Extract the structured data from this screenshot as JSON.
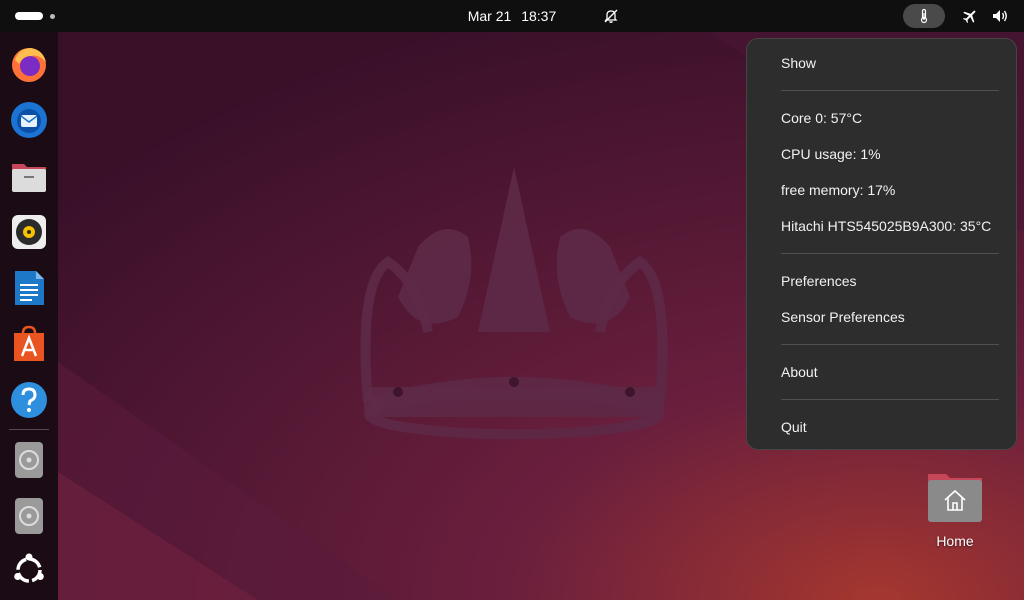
{
  "topbar": {
    "date": "Mar 21",
    "time": "18:37",
    "icons": [
      "bell-off-icon",
      "thermometer-icon",
      "airplane-mode-icon",
      "volume-icon"
    ]
  },
  "dock": {
    "items": [
      "firefox-icon",
      "thunderbird-icon",
      "files-icon",
      "rhythmbox-icon",
      "libreoffice-writer-icon",
      "app-center-icon",
      "help-icon",
      "disc-icon",
      "disc-icon",
      "show-apps-icon"
    ]
  },
  "menu": {
    "show": "Show",
    "core0": "Core 0: 57°C",
    "cpu": "CPU usage: 1%",
    "memory": "free memory: 17%",
    "disk": "Hitachi HTS545025B9A300: 35°C",
    "preferences": "Preferences",
    "sensor_preferences": "Sensor Preferences",
    "about": "About",
    "quit": "Quit"
  },
  "desktop": {
    "home_label": "Home"
  },
  "colors": {
    "topbar": "#0f0f0f",
    "menu_bg": "#2d2d2d",
    "accent_orange": "#e95420"
  }
}
